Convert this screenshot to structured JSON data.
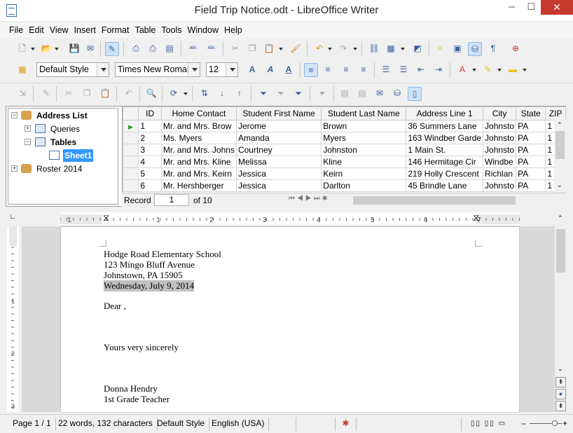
{
  "window": {
    "title": "Field Trip Notice.odt - LibreOffice Writer",
    "min": "─",
    "max": "☐",
    "close": "✕"
  },
  "menu": [
    "File",
    "Edit",
    "View",
    "Insert",
    "Format",
    "Table",
    "Tools",
    "Window",
    "Help"
  ],
  "formatting": {
    "style": "Default Style",
    "font": "Times New Roman",
    "size": "12"
  },
  "datasource": {
    "tree": {
      "root": "Address List",
      "queries": "Queries",
      "tables": "Tables",
      "sheet": "Sheet1",
      "other": "Roster 2014"
    },
    "columns": [
      "ID",
      "Home Contact",
      "Student First Name",
      "Student Last Name",
      "Address Line 1",
      "City",
      "State",
      "ZIP"
    ],
    "rows": [
      [
        "1",
        "Mr. and Mrs. Brow",
        "Jerome",
        "Brown",
        "36 Summers Lane",
        "Johnsto",
        "PA",
        "1"
      ],
      [
        "2",
        "Ms. Myers",
        "Amanda",
        "Myers",
        "163 Windber Garde",
        "Johnsto",
        "PA",
        "1"
      ],
      [
        "3",
        "Mr. and Mrs. Johns",
        "Courtney",
        "Johnston",
        "1 Main St.",
        "Johnsto",
        "PA",
        "1"
      ],
      [
        "4",
        "Mr. and Mrs. Kline",
        "Melissa",
        "Kline",
        "146 Hermitage Cir",
        "Windbe",
        "PA",
        "1"
      ],
      [
        "5",
        "Mr. and Mrs. Keirn",
        "Jessica",
        "Keirn",
        "219 Holly Crescent",
        "Richlan",
        "PA",
        "1"
      ],
      [
        "6",
        "Mr. Hershberger",
        "Jessica",
        "Darlton",
        "45 Brindle Lane",
        "Johnsto",
        "PA",
        "1"
      ]
    ],
    "record_label": "Record",
    "record_value": "1",
    "record_of": "of 10"
  },
  "ruler_numbers": [
    "1",
    "1",
    "2",
    "3",
    "4",
    "5",
    "6",
    "7"
  ],
  "document": {
    "lines": [
      "Hodge Road Elementary School",
      "123 Mingo Bluff Avenue",
      "Johnstown, PA 15905",
      "Wednesday, July 9, 2014",
      "Dear ,",
      "Yours very sincerely",
      "Donna Hendry",
      "1st Grade Teacher"
    ]
  },
  "status": {
    "page": "Page 1 / 1",
    "words": "22 words, 132 characters",
    "style": "Default Style",
    "language": "English (USA)"
  },
  "colors": {
    "selection": "#3399ff",
    "accent": "#3a5e9a",
    "close": "#c7392f"
  }
}
